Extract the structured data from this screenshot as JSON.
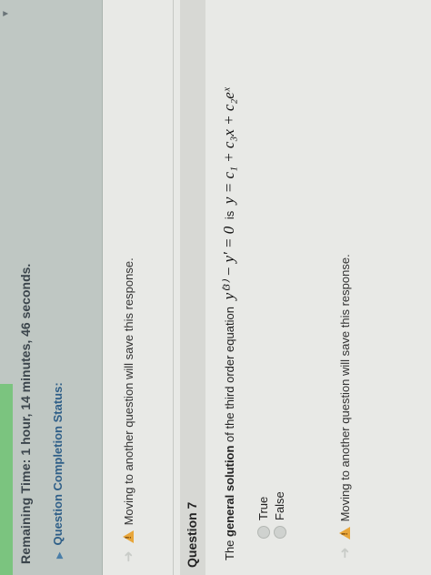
{
  "status": {
    "menu_arrow": "▼",
    "remaining_label": "Remaining Time:",
    "remaining_value": "1 hour, 14 minutes, 46 seconds.",
    "completion_label": "Question Completion Status:"
  },
  "notice_text": "Moving to another question will save this response.",
  "question": {
    "title": "Question 7",
    "text_prefix": "The",
    "text_bold": "general solution",
    "text_mid": "of the third order equation",
    "equation": "y⁽³⁾ − y′ = 0",
    "text_is": "is",
    "solution": "y = c₁ + c₃x + c₂eˣ"
  },
  "options": [
    "True",
    "False"
  ]
}
